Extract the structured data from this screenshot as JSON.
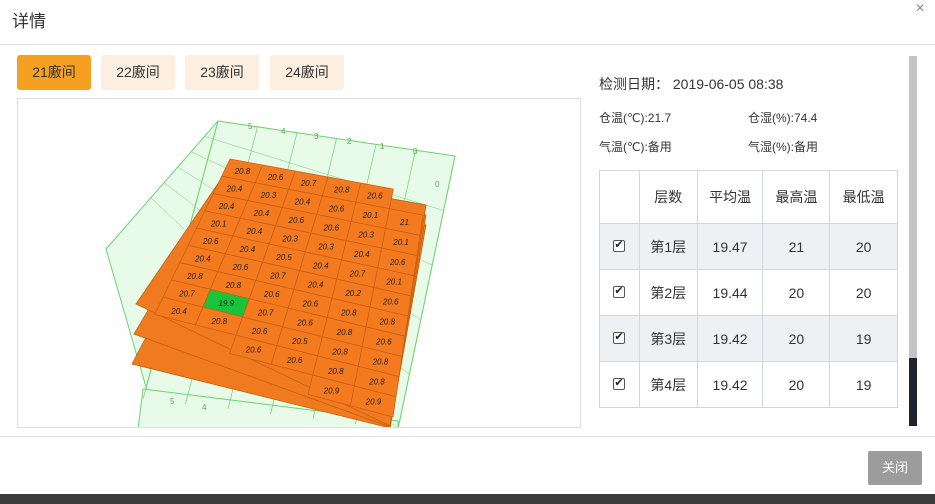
{
  "dialog": {
    "title": "详情",
    "close_icon": "close-icon",
    "close_glyph": "×"
  },
  "tabs": [
    {
      "label": "21廒间",
      "active": true
    },
    {
      "label": "22廒间",
      "active": false
    },
    {
      "label": "23廒间",
      "active": false
    },
    {
      "label": "24廒间",
      "active": false
    }
  ],
  "info": {
    "date": "检测日期： 2019-06-05 08:38",
    "granary_temp": "仓温(℃):21.7",
    "granary_humidity": "仓湿(%):74.4",
    "air_temp": "气温(℃):备用",
    "air_humidity": "气湿(%):备用"
  },
  "table": {
    "headers": [
      "",
      "层数",
      "平均温",
      "最高温",
      "最低温"
    ],
    "rows": [
      {
        "checked": true,
        "layer": "第1层",
        "avg": "19.47",
        "max": "21",
        "min": "20"
      },
      {
        "checked": true,
        "layer": "第2层",
        "avg": "19.44",
        "max": "20",
        "min": "20"
      },
      {
        "checked": true,
        "layer": "第3层",
        "avg": "19.42",
        "max": "20",
        "min": "19"
      },
      {
        "checked": true,
        "layer": "第4层",
        "avg": "19.42",
        "max": "20",
        "min": "19"
      }
    ]
  },
  "footer": {
    "close_label": "关闭"
  },
  "colors": {
    "accent": "#f5a021",
    "cell_normal": "#f47a20",
    "cell_low": "#19c43a",
    "grid": "#6ed36e",
    "panel": "#e8fae8"
  },
  "heatmap": {
    "top_axis_ticks": [
      "5",
      "4",
      "3",
      "2",
      "1",
      "0"
    ],
    "right_axis_ticks": [
      "0"
    ],
    "bottom_axis_ticks": [
      "5",
      "4"
    ],
    "cells": [
      [
        "20.8",
        "20.6",
        "20.7",
        "20.8",
        "20.6",
        ""
      ],
      [
        "20.4",
        "20.3",
        "20.4",
        "20.6",
        "20.1",
        "21"
      ],
      [
        "20.4",
        "20.4",
        "20.6",
        "20.6",
        "20.3",
        "20.1"
      ],
      [
        "20.1",
        "20.4",
        "20.3",
        "20.3",
        "20.4",
        "20.6"
      ],
      [
        "20.6",
        "20.4",
        "20.5",
        "20.4",
        "20.7",
        "20.1"
      ],
      [
        "20.4",
        "20.6",
        "20.7",
        "20.4",
        "20.2",
        "20.6"
      ],
      [
        "20.8",
        "20.8",
        "20.6",
        "20.6",
        "20.8",
        "20.8"
      ],
      [
        "20.7",
        "19.9",
        "20.7",
        "20.6",
        "20.8",
        "20.6"
      ],
      [
        "20.4",
        "20.8",
        "20.6",
        "20.5",
        "20.8",
        "20.8"
      ],
      [
        "",
        "",
        "20.6",
        "20.6",
        "20.8",
        "20.8"
      ],
      [
        "",
        "",
        "",
        "",
        "20.9",
        "20.9"
      ]
    ],
    "low_cell_value": "19.9"
  }
}
